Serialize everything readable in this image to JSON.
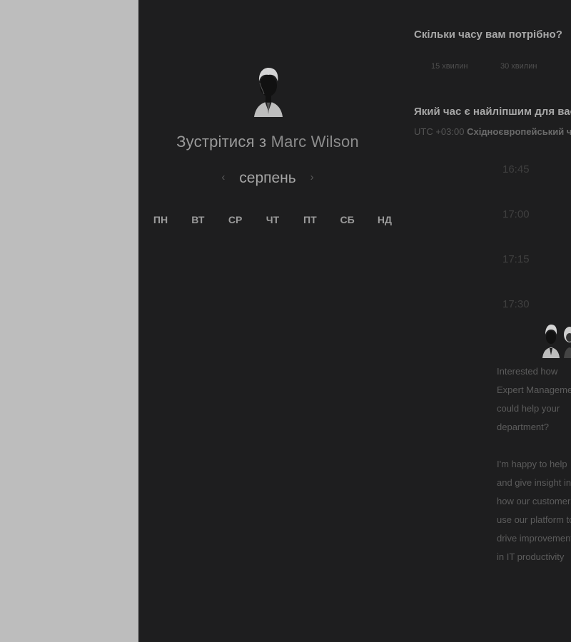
{
  "host": {
    "title_prefix": "Зустрітися з",
    "name": "Marc Wilson"
  },
  "calendar": {
    "month": "серпень",
    "prev_icon": "chevron-left-icon",
    "next_icon": "chevron-right-icon",
    "weekdays": [
      "ПН",
      "ВТ",
      "СР",
      "ЧТ",
      "ПТ",
      "СБ",
      "НД"
    ]
  },
  "duration": {
    "question": "Скільки часу вам потрібно?",
    "options": [
      "15 хвилин",
      "30 хвилин"
    ]
  },
  "time": {
    "question": "Який час є найліпшим для вас?",
    "tz_offset": "UTC +03:00",
    "tz_name": "Східноєвропейський час",
    "slots": [
      "16:45",
      "17:00",
      "17:15",
      "17:30"
    ]
  },
  "blurb": {
    "p1": "Interested how Expert Management could help your department?",
    "p2": "I'm happy to help and give insight into how our customers use our platform to drive improvement in IT productivity"
  },
  "colors": {
    "panel_bg": "#1e1e1f",
    "gutter_bg": "#bdbdbd"
  }
}
